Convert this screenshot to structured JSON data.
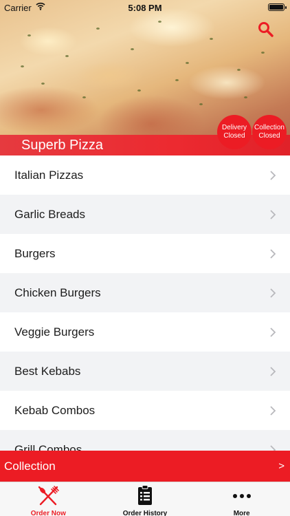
{
  "status_bar": {
    "carrier": "Carrier",
    "time": "5:08 PM"
  },
  "header": {
    "restaurant_name": "Superb Pizza",
    "delivery_status": {
      "line1": "Delivery",
      "line2": "Closed"
    },
    "collection_status": {
      "line1": "Collection",
      "line2": "Closed"
    },
    "search_icon": "search-icon",
    "accent_color": "#ec1c24"
  },
  "menu": {
    "categories": [
      {
        "label": "Italian Pizzas"
      },
      {
        "label": "Garlic Breads"
      },
      {
        "label": "Burgers"
      },
      {
        "label": "Chicken Burgers"
      },
      {
        "label": "Veggie Burgers"
      },
      {
        "label": "Best Kebabs"
      },
      {
        "label": "Kebab Combos"
      },
      {
        "label": "Grill Combos"
      }
    ]
  },
  "order_mode_bar": {
    "label": "Collection",
    "arrow": ">"
  },
  "tab_bar": {
    "tabs": [
      {
        "label": "Order Now",
        "icon": "fork-knife-icon",
        "active": true
      },
      {
        "label": "Order History",
        "icon": "clipboard-list-icon",
        "active": false
      },
      {
        "label": "More",
        "icon": "more-dots-icon",
        "active": false
      }
    ]
  }
}
